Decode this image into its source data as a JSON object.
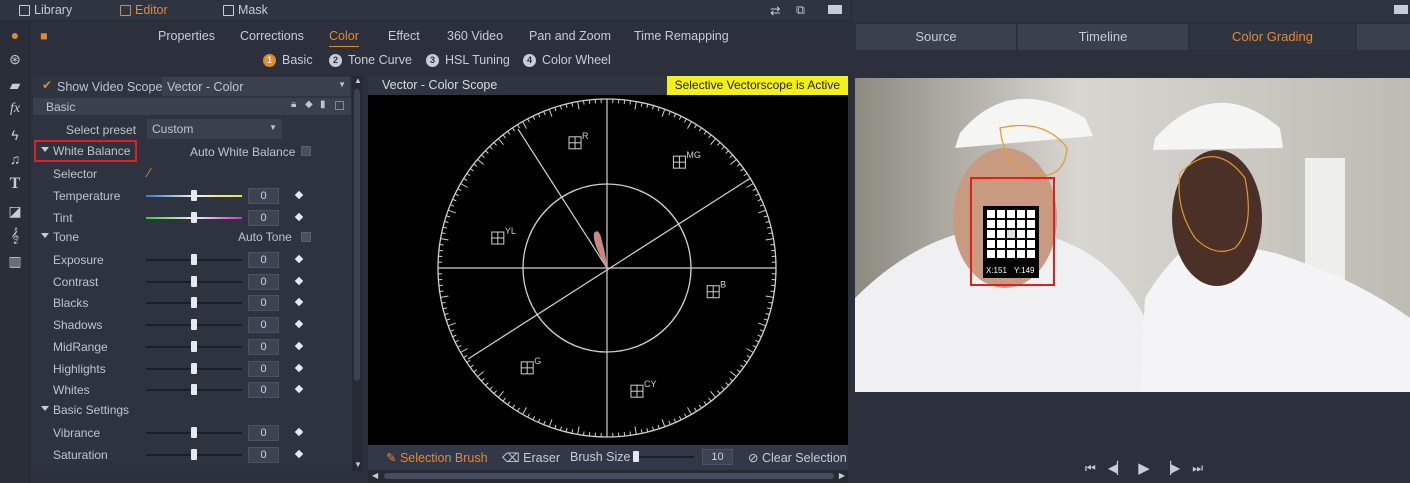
{
  "topbar": {
    "library": "Library",
    "editor": "Editor",
    "mask": "Mask"
  },
  "tabs": [
    "Properties",
    "Corrections",
    "Color",
    "Effect",
    "360 Video",
    "Pan and Zoom",
    "Time Remapping"
  ],
  "active_tab": "Color",
  "subtabs": [
    {
      "n": "1",
      "label": "Basic"
    },
    {
      "n": "2",
      "label": "Tone Curve"
    },
    {
      "n": "3",
      "label": "HSL Tuning"
    },
    {
      "n": "4",
      "label": "Color Wheel"
    }
  ],
  "panel": {
    "show_scope_label": "Show Video Scope",
    "scope_select": "Vector - Color",
    "section": "Basic",
    "preset_label": "Select preset",
    "preset_value": "Custom",
    "white_balance": "White Balance",
    "auto_wb": "Auto White Balance",
    "selector": "Selector",
    "tone": "Tone",
    "auto_tone": "Auto Tone",
    "basic_settings": "Basic Settings",
    "wb_sliders": [
      {
        "label": "Temperature",
        "value": "0"
      },
      {
        "label": "Tint",
        "value": "0"
      }
    ],
    "tone_sliders": [
      {
        "label": "Exposure",
        "value": "0"
      },
      {
        "label": "Contrast",
        "value": "0"
      },
      {
        "label": "Blacks",
        "value": "0"
      },
      {
        "label": "Shadows",
        "value": "0"
      },
      {
        "label": "MidRange",
        "value": "0"
      },
      {
        "label": "Highlights",
        "value": "0"
      },
      {
        "label": "Whites",
        "value": "0"
      }
    ],
    "basic_sliders": [
      {
        "label": "Vibrance",
        "value": "0"
      },
      {
        "label": "Saturation",
        "value": "0"
      }
    ]
  },
  "scope": {
    "title": "Vector - Color Scope",
    "badge": "Selective Vectorscope is Active",
    "targets": [
      "R",
      "MG",
      "B",
      "CY",
      "G",
      "YL"
    ],
    "tools": {
      "brush": "Selection Brush",
      "eraser": "Eraser",
      "size_label": "Brush Size",
      "size_value": "10",
      "clear": "Clear Selection"
    },
    "accent": "#e38a2e"
  },
  "preview": {
    "tabs": [
      "Source",
      "Timeline",
      "Color Grading"
    ],
    "active_tab": "Color Grading",
    "coord_x": "X:151",
    "coord_y": "Y:149"
  }
}
